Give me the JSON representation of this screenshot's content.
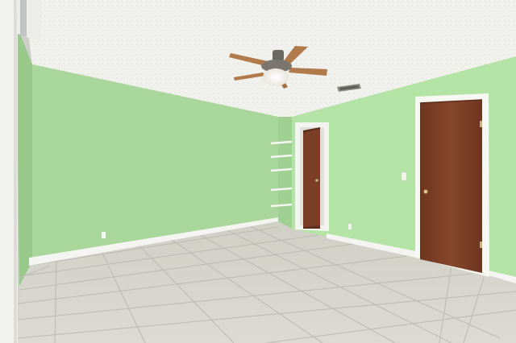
{
  "scene": {
    "kind": "empty-bedroom-interior",
    "colors": {
      "ceiling": "#f2f2ee",
      "left_wall": "#a9d69a",
      "back_wall": "#aadb9c",
      "right_wall": "#b3e4a6",
      "floor_tile": "#d8d7cf",
      "grout": "#bebdb5",
      "baseboard": "#f4f4f0",
      "door_wood": "#7a3f26",
      "door_trim": "#f7f7f3",
      "fan_blade": "#b07a4a",
      "fan_body": "#6b6761"
    },
    "objects": [
      "ceiling-fan",
      "built-in-shelves",
      "open-doorway",
      "closed-wood-door",
      "ceiling-vent",
      "tile-floor",
      "window-frame-edge",
      "light-switch",
      "wall-outlet"
    ]
  }
}
